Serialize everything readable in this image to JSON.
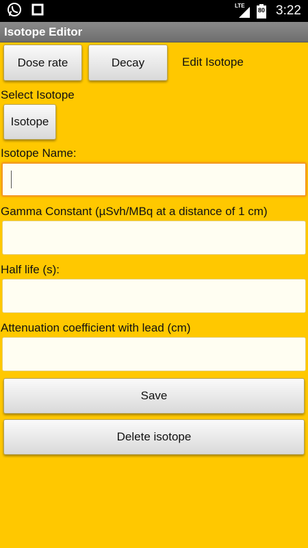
{
  "status_bar": {
    "time": "3:22",
    "network": "LTE",
    "battery_level": "80",
    "icons": [
      "whatsapp-icon",
      "stop-square-icon",
      "lte-signal-icon",
      "battery-icon"
    ]
  },
  "action_bar": {
    "title": "Isotope Editor"
  },
  "tabs": {
    "dose_rate": "Dose rate",
    "decay": "Decay",
    "edit_isotope": "Edit Isotope"
  },
  "form": {
    "select_label": "Select Isotope",
    "isotope_button": "Isotope",
    "name_label": "Isotope Name:",
    "name_value": "",
    "gamma_label": "Gamma Constant (µSvh/MBq at a distance of 1 cm)",
    "gamma_value": "",
    "half_life_label": "Half life (s):",
    "half_life_value": "",
    "attenuation_label": "Attenuation coefficient with lead (cm)",
    "attenuation_value": ""
  },
  "actions": {
    "save": "Save",
    "delete": "Delete isotope"
  },
  "colors": {
    "background": "#FFC800",
    "field_background": "#FFFEF2",
    "focus_border": "#F39A22",
    "action_bar": "#7A7A7A"
  }
}
